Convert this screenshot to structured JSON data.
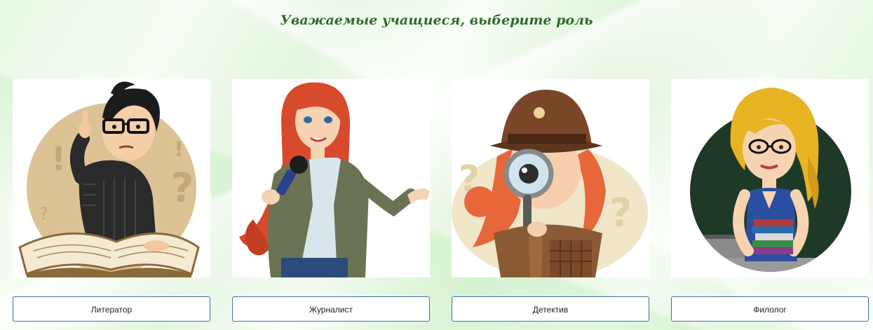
{
  "header": {
    "title": "Уважаемые учащиеся, выберите роль"
  },
  "roles": [
    {
      "label": "Литератор",
      "illustration": "writer-with-book"
    },
    {
      "label": "Журналист",
      "illustration": "journalist-with-microphone"
    },
    {
      "label": "Детектив",
      "illustration": "detective-with-magnifier"
    },
    {
      "label": "Филолог",
      "illustration": "teacher-with-books"
    }
  ],
  "colors": {
    "title": "#2f6b2c",
    "button_border": "#3e6fa3",
    "background": "#e9f9e6"
  }
}
